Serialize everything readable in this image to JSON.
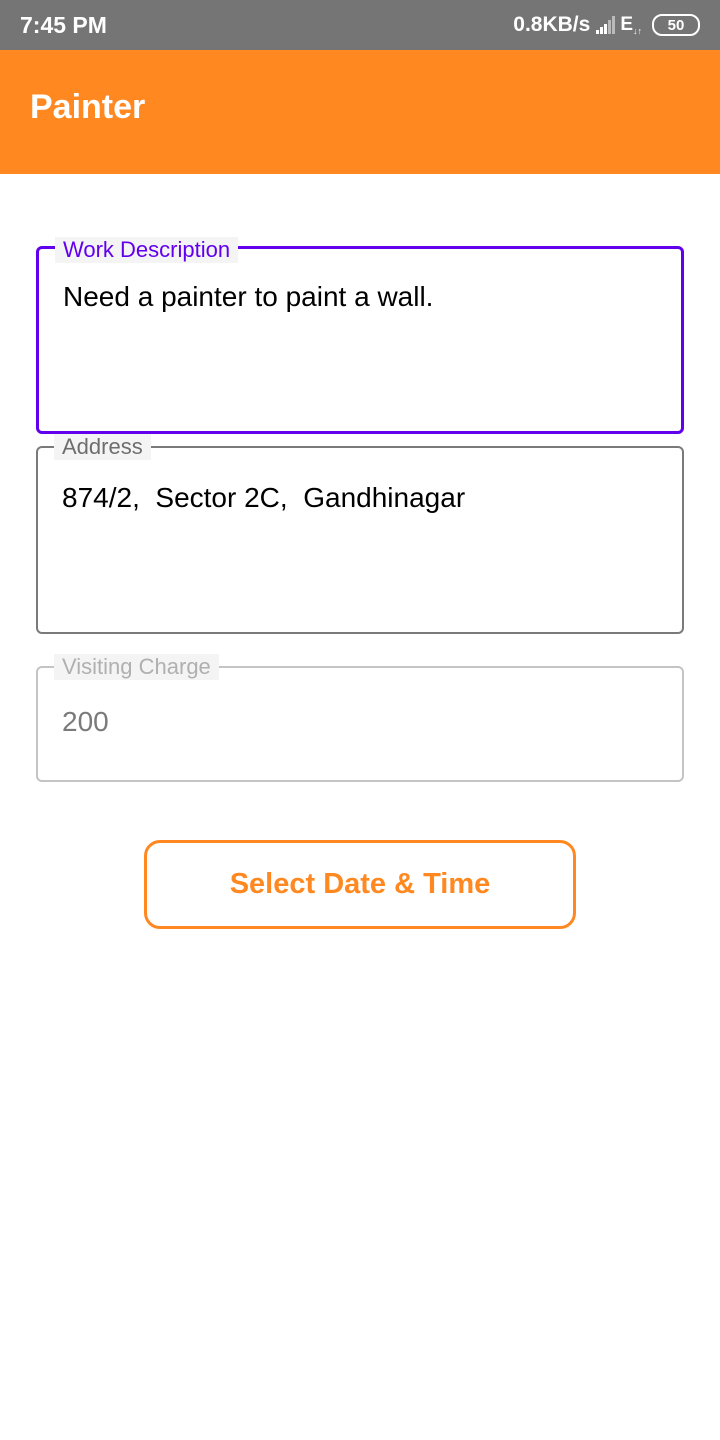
{
  "status_bar": {
    "time": "7:45 PM",
    "speed": "0.8KB/s",
    "network": "E",
    "battery": "50"
  },
  "app_bar": {
    "title": "Painter"
  },
  "form": {
    "work_description": {
      "label": "Work Description",
      "value": "Need a painter to paint a wall."
    },
    "address": {
      "label": "Address",
      "value": "874/2,  Sector 2C,  Gandhinagar"
    },
    "visiting_charge": {
      "label": "Visiting Charge",
      "value": "200"
    }
  },
  "actions": {
    "select_datetime_label": "Select Date & Time"
  },
  "colors": {
    "accent": "#ff8820",
    "focus": "#6200ee",
    "status_bar": "#757575"
  }
}
